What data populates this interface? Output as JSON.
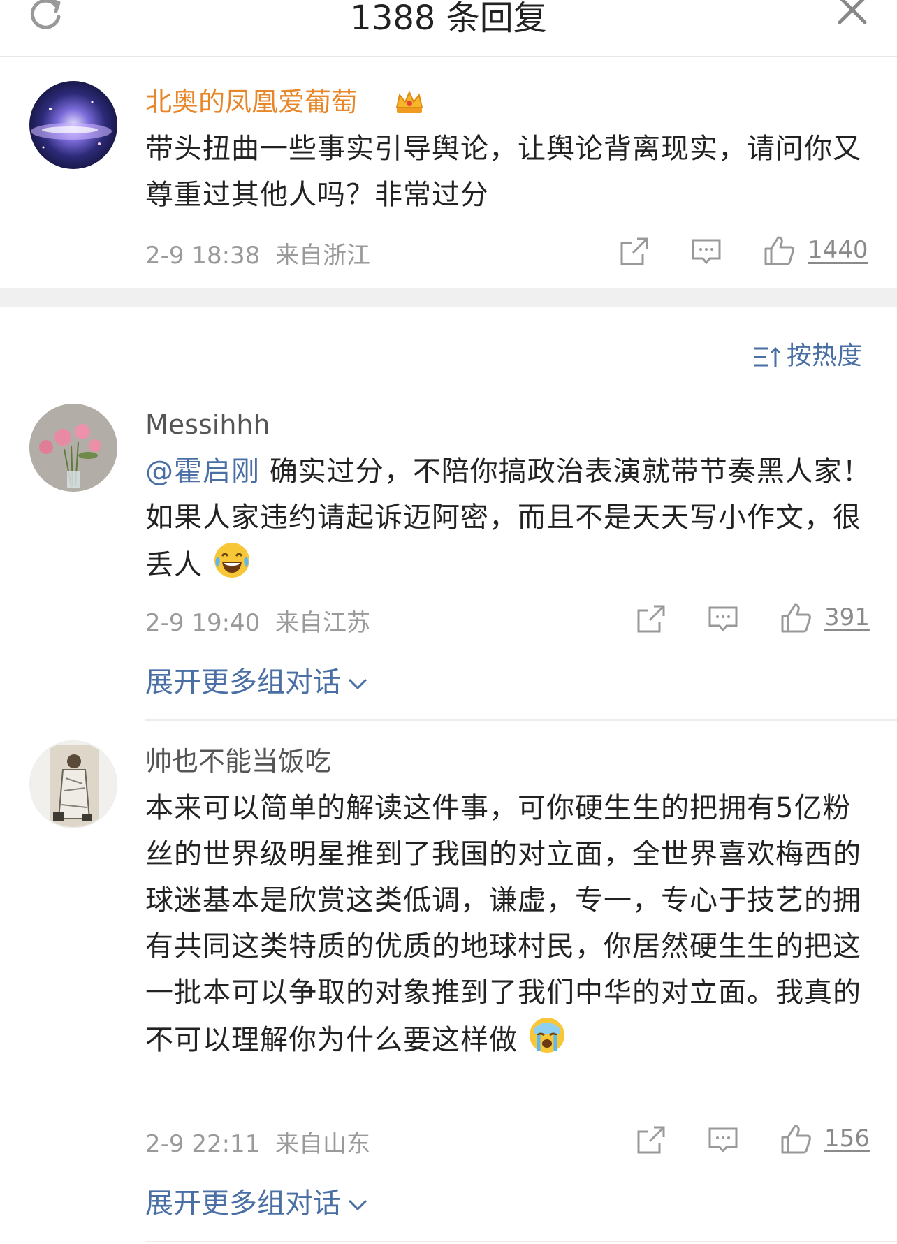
{
  "header": {
    "title": "1388 条回复",
    "refresh_icon": "refresh-icon",
    "close_icon": "close-icon"
  },
  "top_comment": {
    "username": "北奥的凤凰爱葡萄",
    "badge_icon": "crown-icon",
    "text": "带头扭曲一些事实引导舆论，让舆论背离现实，请问你又尊重过其他人吗？非常过分",
    "timestamp": "2-9 18:38",
    "location": "来自浙江",
    "likes": "1440"
  },
  "sort": {
    "label": "按热度",
    "icon": "sort-icon"
  },
  "replies": [
    {
      "username": "Messihhh",
      "mention": "@霍启刚",
      "text": " 确实过分，不陪你搞政治表演就带节奏黑人家！如果人家违约请起诉迈阿密，而且不是天天写小作文，很丢人",
      "emoji": "laughing-crying-emoji",
      "timestamp": "2-9 19:40",
      "location": "来自江苏",
      "likes": "391",
      "expand": "展开更多组对话"
    },
    {
      "username": "帅也不能当饭吃",
      "text": "本来可以简单的解读这件事，可你硬生生的把拥有5亿粉丝的世界级明星推到了我国的对立面，全世界喜欢梅西的球迷基本是欣赏这类低调，谦虚，专一，专心于技艺的拥有共同这类特质的优质的地球村民，你居然硬生生的把这一批本可以争取的对象推到了我们中华的对立面。我真的不可以理解你为什么要这样做",
      "emoji": "crying-emoji",
      "timestamp": "2-9 22:11",
      "location": "来自山东",
      "likes": "156",
      "expand": "展开更多组对话"
    }
  ],
  "colors": {
    "username_top": "#e8862a",
    "link": "#4a6fa5",
    "meta": "#9a9a9a",
    "separator": "#f0f0f0"
  }
}
